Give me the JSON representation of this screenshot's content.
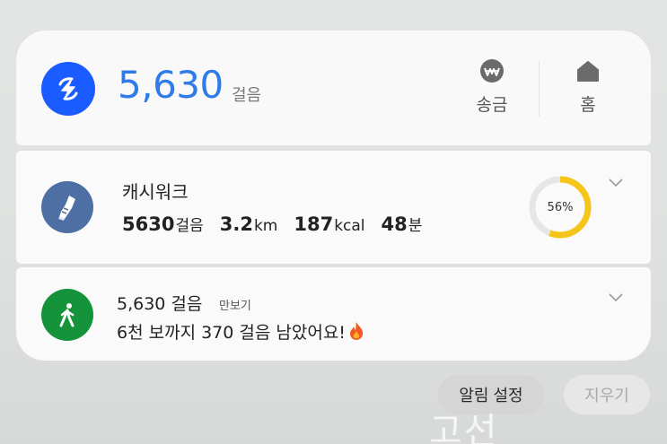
{
  "top_card": {
    "steps": "5,630",
    "steps_unit": "걸음",
    "actions": [
      {
        "icon": "won-coin-icon",
        "label": "송금"
      },
      {
        "icon": "home-icon",
        "label": "홈"
      }
    ]
  },
  "cashwalk": {
    "title": "캐시워크",
    "stats": [
      {
        "value": "5630",
        "unit": "걸음"
      },
      {
        "value": "3.2",
        "unit": "km"
      },
      {
        "value": "187",
        "unit": "kcal"
      },
      {
        "value": "48",
        "unit": "분"
      }
    ],
    "progress_label": "56%",
    "progress": 0.56,
    "ring_color": "#f5c518"
  },
  "pedometer": {
    "title": "5,630 걸음",
    "app_name": "만보기",
    "message": "6천 보까지 370 걸음 남았어요!"
  },
  "footer": {
    "settings_label": "알림 설정",
    "clear_label": "지우기"
  },
  "watermark": "고선",
  "colors": {
    "pay_blue": "#1a5cff",
    "steps_blue": "#2f7be8",
    "cashwalk_blue": "#4e6fa3",
    "walk_green": "#14933a"
  }
}
